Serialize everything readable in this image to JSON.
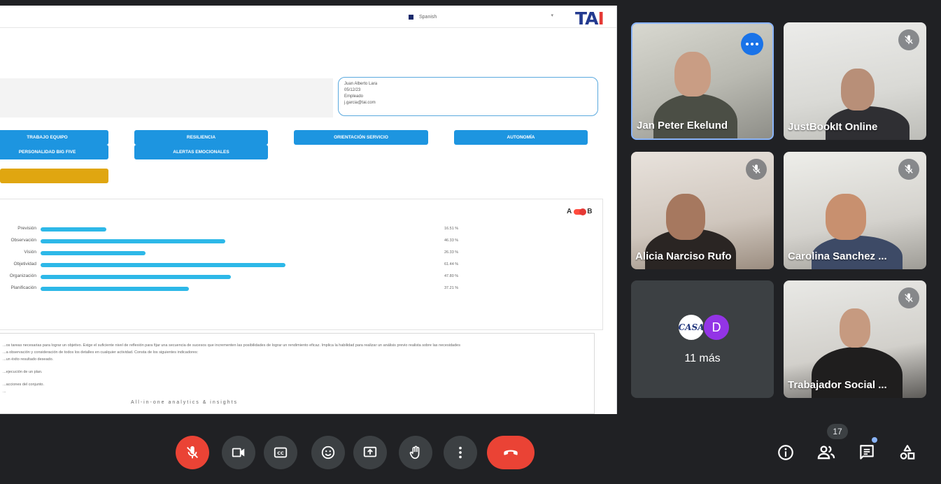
{
  "screen": {
    "language_select": "Spanish",
    "logo": {
      "main": "TA",
      "accent": "I"
    },
    "user_card": {
      "name": "Juan Alberto Lara",
      "date": "05/12/23",
      "role": "Empleado",
      "email": "j.garcia@tai.com"
    },
    "tabs": [
      "TRABAJO EQUIPO",
      "RESILIENCIA",
      "ORIENTACIÓN SERVICIO",
      "AUTONOMÍA",
      "PERSONALIDAD BIG FIVE",
      "ALERTAS EMOCIONALES"
    ],
    "toggle": {
      "a": "A",
      "b": "B"
    },
    "text_lines": [
      "...os tareas necesarias para lograr un objetivo. Exige el suficiente nivel de reflexión para fijar una secuencia de sucesos que incrementen las posibilidades de lograr un rendimiento eficaz. Implica la habilidad para realizar un análisis previo realista sobre las necesidades",
      "...a observación y consideración de todos los detalles en cualquier actividad. Consta de los siguientes indicadores:",
      "...un éxito resultado deseado.",
      "...ejecución de un plan.",
      "...acciones del conjunto.",
      "..."
    ],
    "footer_note": "All-in-one analytics & insights"
  },
  "chart_data": {
    "type": "bar",
    "orientation": "horizontal",
    "categories": [
      "Previsión",
      "Observación",
      "Visión",
      "Objetividad",
      "Organización",
      "Planificación"
    ],
    "values": [
      16.51,
      46.33,
      26.33,
      61.44,
      47.8,
      37.21
    ],
    "value_labels": [
      "16.51 %",
      "46.33 %",
      "26.33 %",
      "61.44 %",
      "47.80 %",
      "37.21 %"
    ],
    "xlim": [
      0,
      100
    ],
    "color": "#2db8e8"
  },
  "participants": [
    {
      "name": "Jan Peter Ekelund",
      "muted": false,
      "active": true
    },
    {
      "name": "JustBookIt Online",
      "muted": true
    },
    {
      "name": "Alicia Narciso Rufo",
      "muted": true
    },
    {
      "name": "Carolina Sanchez ...",
      "muted": true
    },
    {
      "name": "Trabajador Social ...",
      "muted": true
    }
  ],
  "more_tile": {
    "avatar_casa": "CASA",
    "avatar_d": "D",
    "label": "11 más"
  },
  "controls": {
    "people_count": "17"
  },
  "colors": {
    "meet_bg": "#202124",
    "button_gray": "#3c4043",
    "danger": "#ea4335",
    "accent_blue": "#1a73e8",
    "tab_blue": "#1d95e0",
    "bar_blue": "#2db8e8"
  }
}
